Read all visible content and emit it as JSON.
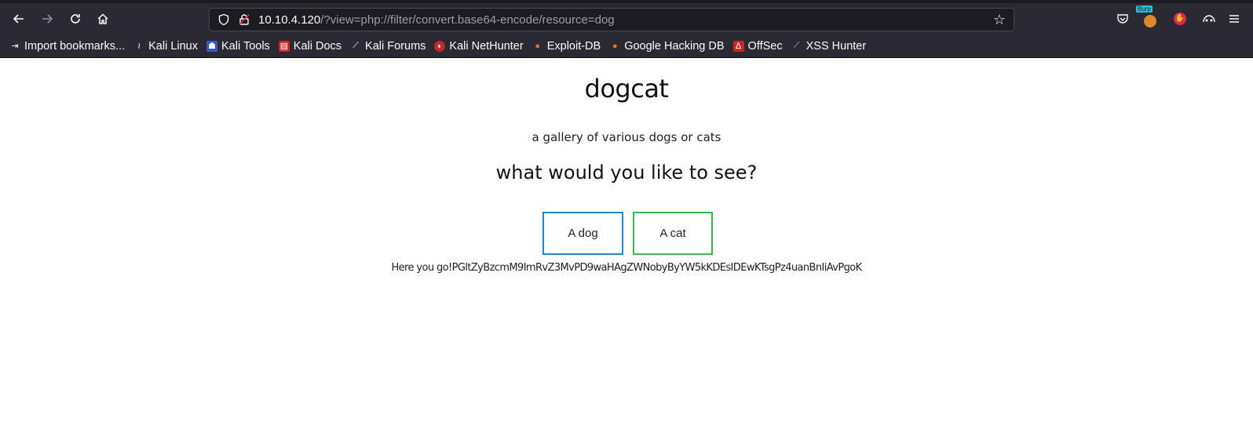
{
  "browser": {
    "url_host": "10.10.4.120",
    "url_path": "/?view=php://filter/convert.base64-encode/resource=dog",
    "burp_badge": "Burp"
  },
  "bookmarks": [
    {
      "label": "Import bookmarks...",
      "icon": "import-icon"
    },
    {
      "label": "Kali Linux",
      "icon": "kali-dragon-icon"
    },
    {
      "label": "Kali Tools",
      "icon": "kali-tools-icon"
    },
    {
      "label": "Kali Docs",
      "icon": "kali-docs-icon"
    },
    {
      "label": "Kali Forums",
      "icon": "kali-forums-icon"
    },
    {
      "label": "Kali NetHunter",
      "icon": "nethunter-icon"
    },
    {
      "label": "Exploit-DB",
      "icon": "exploit-db-icon"
    },
    {
      "label": "Google Hacking DB",
      "icon": "ghdb-icon"
    },
    {
      "label": "OffSec",
      "icon": "offsec-icon"
    },
    {
      "label": "XSS Hunter",
      "icon": "xss-hunter-icon"
    }
  ],
  "page": {
    "title": "dogcat",
    "subtitle": "a gallery of various dogs or cats",
    "question": "what would you like to see?",
    "dog_button": "A dog",
    "cat_button": "A cat",
    "result_text": "Here you go!PGltZyBzcmM9ImRvZ3MvPD9waHAgZWNobyByYW5kKDEsIDEwKTsgPz4uanBnIiAvPgoK"
  },
  "colors": {
    "chrome_bg": "#2b2a33",
    "url_bg": "#1c1b22",
    "dog_border": "#1e88cf",
    "cat_border": "#3cb64a"
  }
}
